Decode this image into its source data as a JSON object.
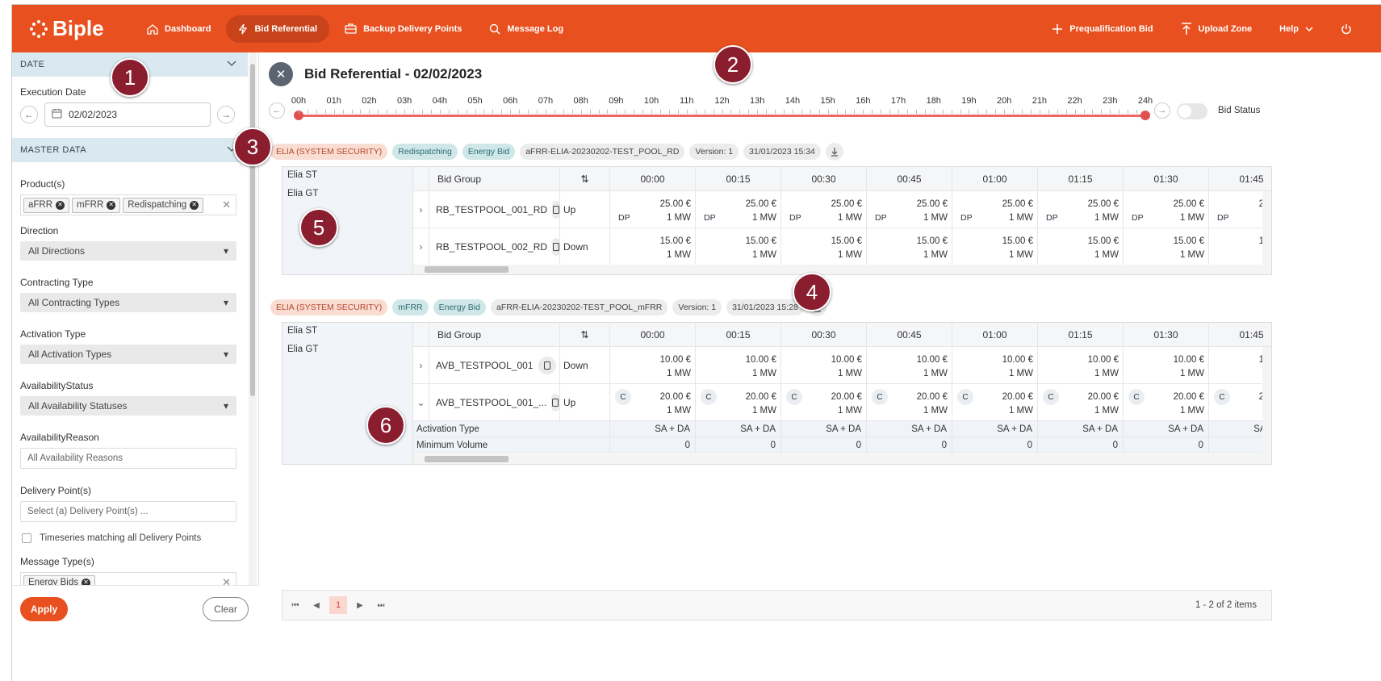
{
  "app": {
    "name": "Biple"
  },
  "nav": {
    "items": [
      {
        "label": "Dashboard",
        "icon": "home-icon",
        "active": false
      },
      {
        "label": "Bid Referential",
        "icon": "lightning-icon",
        "active": true
      },
      {
        "label": "Backup Delivery Points",
        "icon": "briefcase-icon",
        "active": false
      },
      {
        "label": "Message Log",
        "icon": "search-icon",
        "active": false
      }
    ],
    "right": {
      "prequal": "Prequalification Bid",
      "upload": "Upload Zone",
      "help": "Help"
    }
  },
  "sidebar": {
    "date_section": "DATE",
    "execution_date_label": "Execution Date",
    "execution_date": "02/02/2023",
    "master_section": "MASTER DATA",
    "products_label": "Product(s)",
    "products": [
      "aFRR",
      "mFRR",
      "Redispatching"
    ],
    "direction_label": "Direction",
    "direction": "All Directions",
    "contracting_label": "Contracting Type",
    "contracting": "All Contracting Types",
    "activation_label": "Activation Type",
    "activation": "All Activation Types",
    "avail_status_label": "AvailabilityStatus",
    "avail_status": "All Availability Statuses",
    "avail_reason_label": "AvailabilityReason",
    "avail_reason_placeholder": "All Availability Reasons",
    "delivery_label": "Delivery Point(s)",
    "delivery_placeholder": "Select (a) Delivery Point(s) ...",
    "timeseries_label": "Timeseries matching all Delivery Points",
    "message_type_label": "Message Type(s)",
    "message_types": [
      "Energy Bids"
    ],
    "apply": "Apply",
    "clear": "Clear"
  },
  "main": {
    "title": "Bid Referential - 02/02/2023",
    "hours": [
      "00h",
      "01h",
      "02h",
      "03h",
      "04h",
      "05h",
      "06h",
      "07h",
      "08h",
      "09h",
      "10h",
      "11h",
      "12h",
      "13h",
      "14h",
      "15h",
      "16h",
      "17h",
      "18h",
      "19h",
      "20h",
      "21h",
      "22h",
      "23h",
      "24h"
    ],
    "bid_status": "Bid Status",
    "side_list": [
      "Elia ST",
      "Elia GT"
    ],
    "col_bid_group": "Bid Group",
    "times": [
      "00:00",
      "00:15",
      "00:30",
      "00:45",
      "01:00",
      "01:15",
      "01:30",
      "01:45"
    ],
    "panels": [
      {
        "tags": [
          "ELIA (SYSTEM SECURITY)",
          "Redispatching",
          "Energy Bid",
          "aFRR-ELIA-20230202-TEST_POOL_RD",
          "Version: 1",
          "31/01/2023 15:34"
        ],
        "rows": [
          {
            "name": "RB_TESTPOOL_001_RD",
            "direction": "Up",
            "price": "25.00 €",
            "volume": "1 MW",
            "badge": "DP",
            "expanded": false
          },
          {
            "name": "RB_TESTPOOL_002_RD",
            "direction": "Down",
            "price": "15.00 €",
            "volume": "1 MW",
            "badge": "",
            "expanded": false
          }
        ]
      },
      {
        "tags": [
          "ELIA (SYSTEM SECURITY)",
          "mFRR",
          "Energy Bid",
          "aFRR-ELIA-20230202-TEST_POOL_mFRR",
          "Version: 1",
          "31/01/2023 15:28"
        ],
        "rows": [
          {
            "name": "AVB_TESTPOOL_001",
            "direction": "Down",
            "price": "10.00 €",
            "volume": "1 MW",
            "badge": "",
            "expanded": false
          },
          {
            "name": "AVB_TESTPOOL_001_...",
            "direction": "Up",
            "price": "20.00 €",
            "volume": "1 MW",
            "badge": "C",
            "expanded": true
          }
        ],
        "details": [
          {
            "label": "Activation Type",
            "value": "SA + DA"
          },
          {
            "label": "Minimum Volume",
            "value": "0"
          }
        ]
      }
    ],
    "pager": {
      "page": "1",
      "info": "1 - 2 of 2 items"
    }
  },
  "markers": [
    "1",
    "2",
    "3",
    "4",
    "5",
    "6"
  ],
  "colors": {
    "brand": "#e8501f",
    "marker": "#8a1d2e",
    "timeline": "#e05050"
  }
}
